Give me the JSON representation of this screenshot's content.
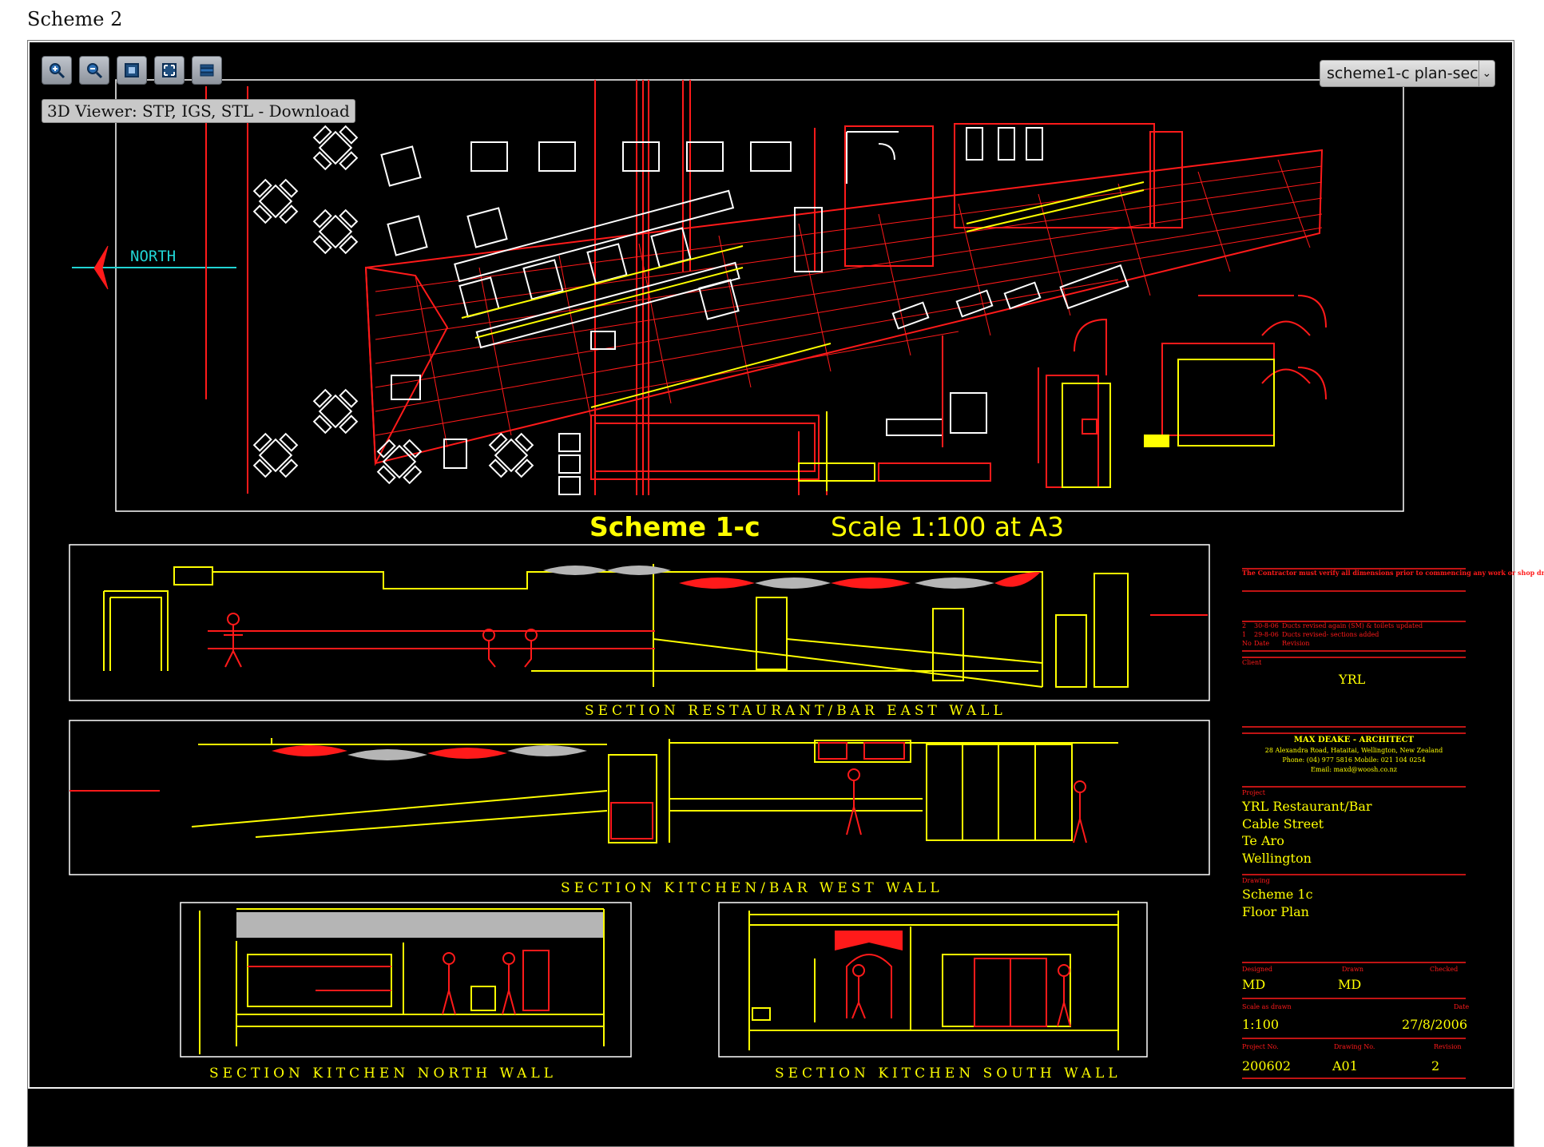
{
  "page": {
    "heading": "Scheme 2"
  },
  "viewer": {
    "toolbar": [
      {
        "name": "zoom-in-icon",
        "tooltip": "Zoom in"
      },
      {
        "name": "zoom-out-icon",
        "tooltip": "Zoom out"
      },
      {
        "name": "zoom-window-icon",
        "tooltip": "Zoom window"
      },
      {
        "name": "zoom-extents-icon",
        "tooltip": "Zoom extents"
      },
      {
        "name": "layers-icon",
        "tooltip": "Layers"
      }
    ],
    "download_link": "3D Viewer: STP, IGS, STL - Download",
    "layout_select": {
      "value": "scheme1-c plan-sec"
    }
  },
  "drawing": {
    "north_label": "NORTH",
    "plan_title": "Scheme 1-c",
    "plan_scale": "Scale 1:100 at A3",
    "section_east": "SECTION RESTAURANT/BAR EAST WALL",
    "section_west": "SECTION KITCHEN/BAR WEST WALL",
    "section_north": "SECTION KITCHEN NORTH WALL",
    "section_south": "SECTION KITCHEN SOUTH WALL",
    "title_block": {
      "note": "The Contractor must verify all dimensions prior to commencing any work or shop drawings. Do not scale the drawings.",
      "revisions": [
        {
          "no": "2",
          "date": "30-8-06",
          "text": "Ducts revised again (SM) & toilets updated"
        },
        {
          "no": "1",
          "date": "29-8-06",
          "text": "Ducts revised- sections added"
        }
      ],
      "revision_headers": {
        "no": "No",
        "date": "Date",
        "revision": "Revision"
      },
      "client_label": "Client",
      "client": "YRL",
      "architect": "MAX DEAKE - ARCHITECT",
      "address": "28 Alexandra Road, Hataitai, Wellington, New Zealand",
      "phone": "Phone: (04) 977 5816  Mobile: 021 104 0254",
      "email": "Email: maxd@woosh.co.nz",
      "project_label": "Project",
      "project_lines": [
        "YRL Restaurant/Bar",
        "Cable Street",
        "Te Aro",
        "Wellington"
      ],
      "drawing_label": "Drawing",
      "drawing_lines": [
        "Scheme 1c",
        "Floor Plan"
      ],
      "designed_label": "Designed",
      "designed": "MD",
      "drawn_label": "Drawn",
      "drawn": "MD",
      "checked_label": "Checked",
      "scale_label": "Scale as drawn",
      "scale": "1:100",
      "date_label": "Date",
      "date": "27/8/2006",
      "project_no_label": "Project No.",
      "project_no": "200602",
      "drawing_no_label": "Drawing No.",
      "drawing_no": "A01",
      "revision_label": "Revision",
      "revision": "2"
    }
  },
  "colors": {
    "red": "#ff1a1a",
    "yellow": "#ffff00",
    "white": "#ffffff",
    "cyan": "#21d4d4",
    "grey": "#b5b5b5"
  }
}
